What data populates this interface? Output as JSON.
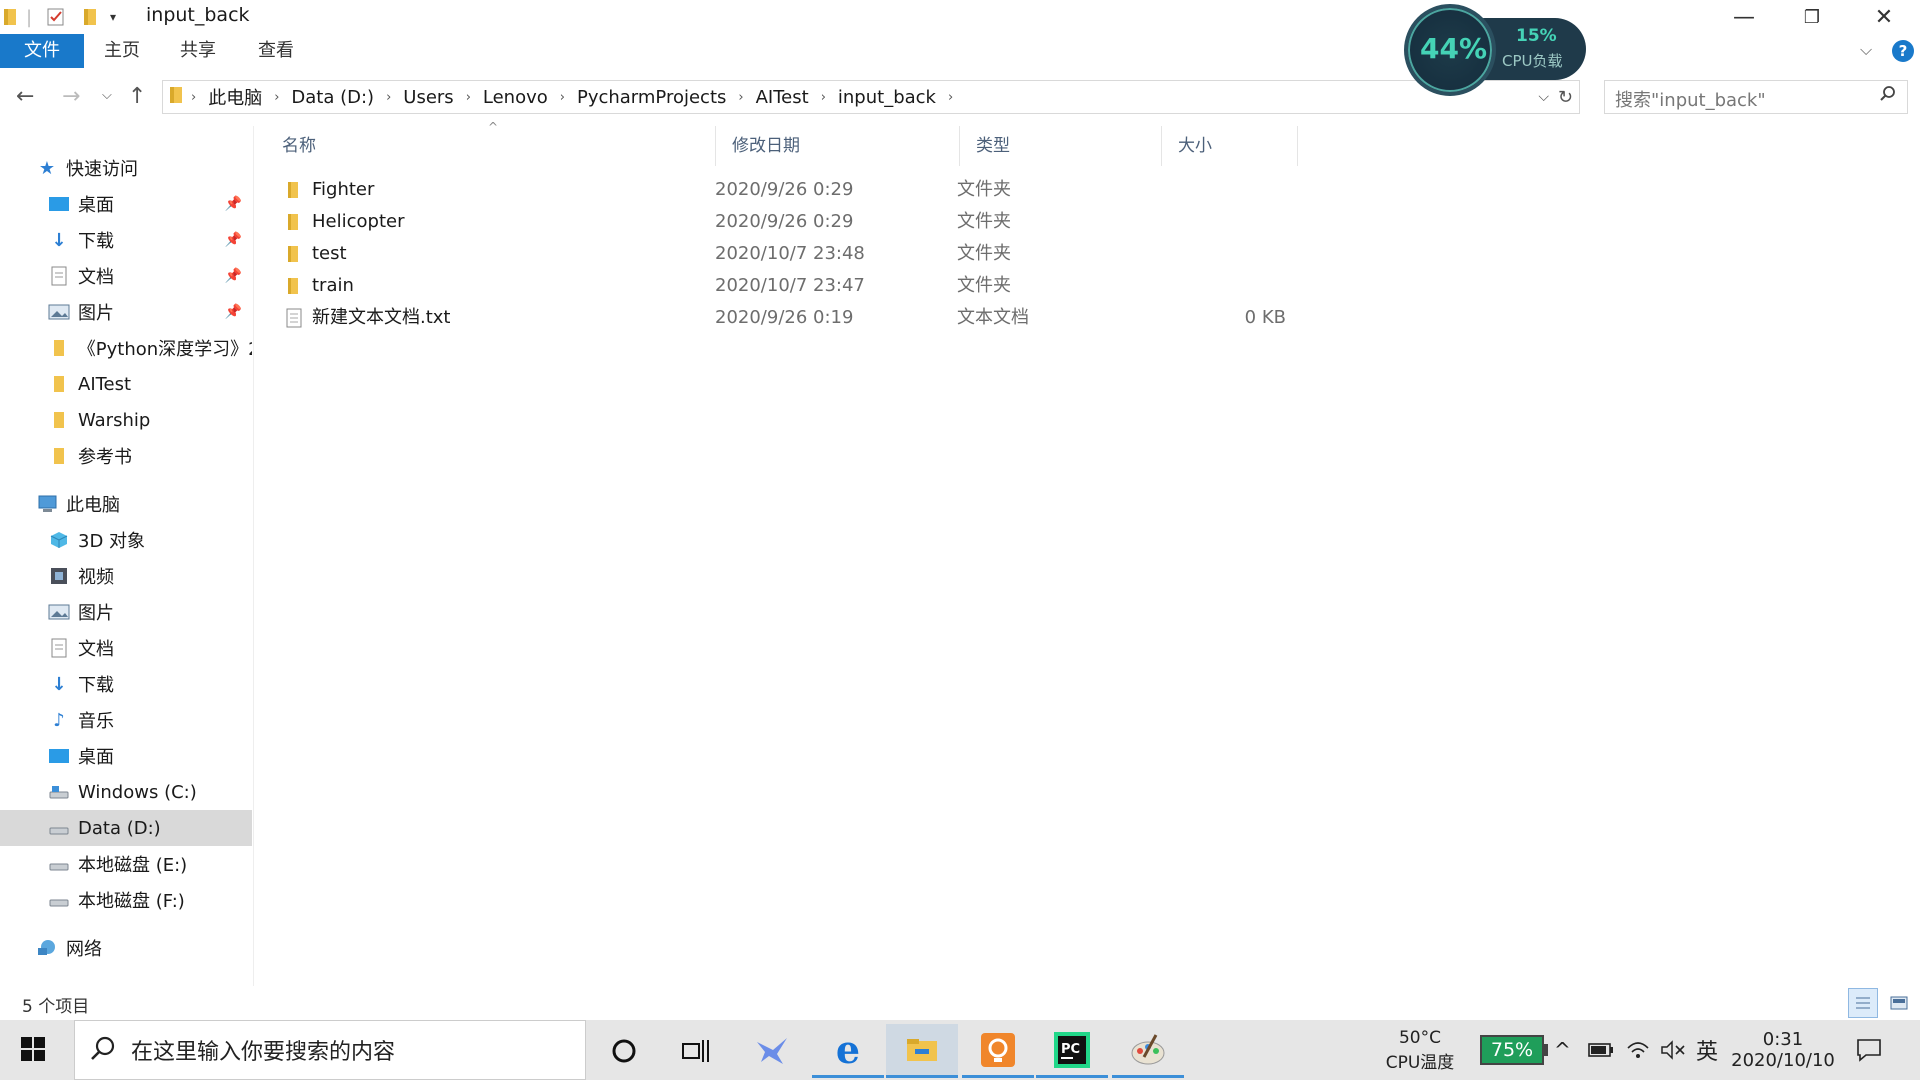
{
  "window": {
    "title": "input_back",
    "controls": [
      "—",
      "❐",
      "✕"
    ]
  },
  "ribbon": {
    "tabs": [
      "文件",
      "主页",
      "共享",
      "查看"
    ]
  },
  "address": {
    "crumbs": [
      "此电脑",
      "Data (D:)",
      "Users",
      "Lenovo",
      "PycharmProjects",
      "AITest",
      "input_back"
    ],
    "search_placeholder": "搜索\"input_back\""
  },
  "cpu_widget": {
    "usage": "44%",
    "load_pct": "15%",
    "load_label": "CPU负载"
  },
  "nav": {
    "quick_access": "快速访问",
    "quick_items": [
      {
        "label": "桌面",
        "icon": "desktop-icon",
        "pinned": true
      },
      {
        "label": "下载",
        "icon": "download-icon",
        "pinned": true
      },
      {
        "label": "文档",
        "icon": "document-icon",
        "pinned": true
      },
      {
        "label": "图片",
        "icon": "picture-icon",
        "pinned": true
      },
      {
        "label": "《Python深度学习》2",
        "icon": "folder-icon",
        "pinned": false
      },
      {
        "label": "AITest",
        "icon": "folder-icon",
        "pinned": false
      },
      {
        "label": "Warship",
        "icon": "folder-icon",
        "pinned": false
      },
      {
        "label": "参考书",
        "icon": "folder-icon",
        "pinned": false
      }
    ],
    "this_pc": "此电脑",
    "pc_items": [
      {
        "label": "3D 对象",
        "icon": "cube-icon"
      },
      {
        "label": "视频",
        "icon": "video-icon"
      },
      {
        "label": "图片",
        "icon": "picture-icon"
      },
      {
        "label": "文档",
        "icon": "document-icon"
      },
      {
        "label": "下载",
        "icon": "download-icon"
      },
      {
        "label": "音乐",
        "icon": "music-icon"
      },
      {
        "label": "桌面",
        "icon": "desktop-icon"
      },
      {
        "label": "Windows (C:)",
        "icon": "drive-icon"
      },
      {
        "label": "Data (D:)",
        "icon": "drive-icon",
        "selected": true
      },
      {
        "label": "本地磁盘 (E:)",
        "icon": "drive-icon"
      },
      {
        "label": "本地磁盘 (F:)",
        "icon": "drive-icon"
      }
    ],
    "network": "网络"
  },
  "columns": {
    "name": "名称",
    "date": "修改日期",
    "type": "类型",
    "size": "大小"
  },
  "files": [
    {
      "name": "Fighter",
      "date": "2020/9/26 0:29",
      "type": "文件夹",
      "size": "",
      "icon": "folder-icon"
    },
    {
      "name": "Helicopter",
      "date": "2020/9/26 0:29",
      "type": "文件夹",
      "size": "",
      "icon": "folder-icon"
    },
    {
      "name": "test",
      "date": "2020/10/7 23:48",
      "type": "文件夹",
      "size": "",
      "icon": "folder-icon"
    },
    {
      "name": "train",
      "date": "2020/10/7 23:47",
      "type": "文件夹",
      "size": "",
      "icon": "folder-icon"
    },
    {
      "name": "新建文本文档.txt",
      "date": "2020/9/26 0:19",
      "type": "文本文档",
      "size": "0 KB",
      "icon": "text-file-icon"
    }
  ],
  "status": {
    "item_count": "5 个项目"
  },
  "taskbar": {
    "search_placeholder": "在这里输入你要搜索的内容",
    "temp_value": "50°C",
    "temp_label": "CPU温度",
    "battery": "75%",
    "ime": "英",
    "time": "0:31",
    "date": "2020/10/10"
  },
  "colors": {
    "accent": "#1979ca",
    "folder": "#f1c34d",
    "selection": "#d9d9d9"
  }
}
